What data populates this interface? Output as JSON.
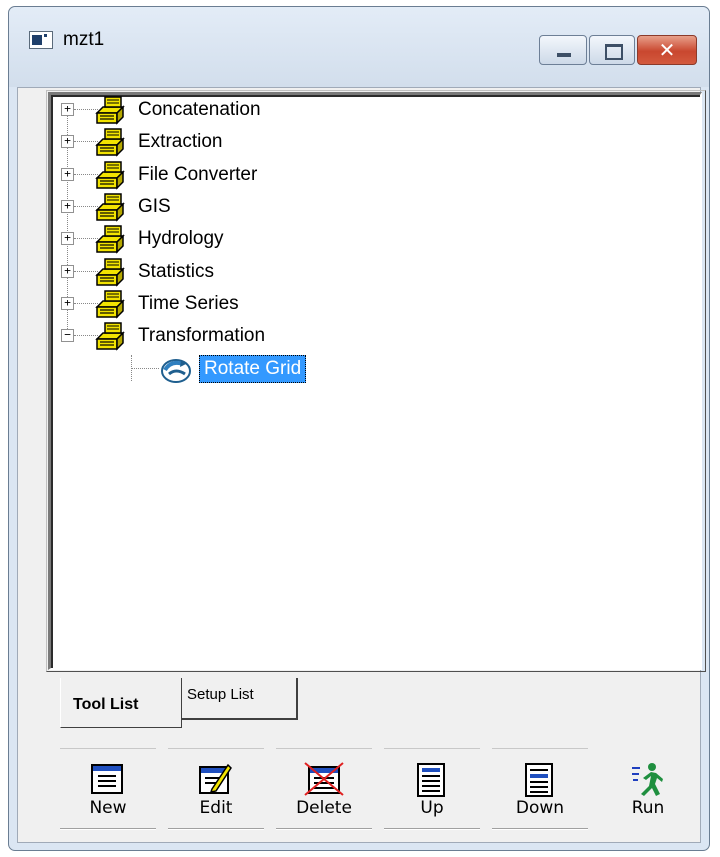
{
  "window": {
    "title": "mzt1",
    "close_glyph": "✕"
  },
  "tree": {
    "categories": [
      {
        "label": "Concatenation",
        "expander": "+"
      },
      {
        "label": "Extraction",
        "expander": "+"
      },
      {
        "label": "File Converter",
        "expander": "+"
      },
      {
        "label": "GIS",
        "expander": "+"
      },
      {
        "label": "Hydrology",
        "expander": "+"
      },
      {
        "label": "Statistics",
        "expander": "+"
      },
      {
        "label": "Time Series",
        "expander": "+"
      },
      {
        "label": "Transformation",
        "expander": "−"
      }
    ],
    "selected_child": {
      "label": "Rotate Grid",
      "icon": "rotate-grid-icon"
    },
    "folder_icon": "folder-stack-icon"
  },
  "tabs": [
    {
      "label": "Tool List",
      "active": true
    },
    {
      "label": "Setup List",
      "active": false
    }
  ],
  "toolbar": {
    "new_label": "New",
    "edit_label": "Edit",
    "delete_label": "Delete",
    "up_label": "Up",
    "down_label": "Down",
    "run_label": "Run"
  },
  "colors": {
    "selection": "#3399ff",
    "folder_yellow": "#f2e300",
    "window_frame": "#dbe6f3",
    "close_red": "#c9472f"
  }
}
